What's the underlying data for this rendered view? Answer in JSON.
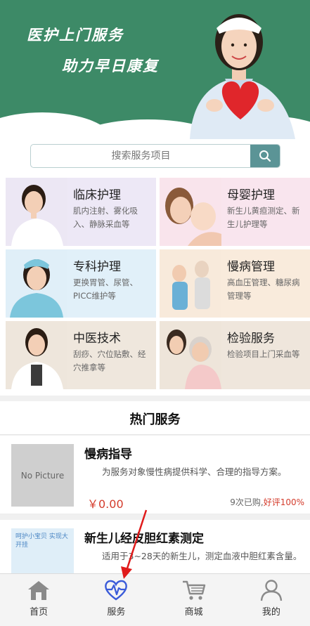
{
  "banner": {
    "line1": "医护上门服务",
    "line2": "助力早日康复"
  },
  "search": {
    "placeholder": "搜索服务项目"
  },
  "categories": [
    {
      "title": "临床护理",
      "desc": "肌内注射、雾化吸入、静脉采血等",
      "bg": "#ede8f6"
    },
    {
      "title": "母婴护理",
      "desc": "新生儿黄疸测定、新生儿护理等",
      "bg": "#f9e5ee"
    },
    {
      "title": "专科护理",
      "desc": "更换胃管、尿管、PICC维护等",
      "bg": "#e1f0f9"
    },
    {
      "title": "慢病管理",
      "desc": "高血压管理、糖尿病管理等",
      "bg": "#f9ebdc"
    },
    {
      "title": "中医技术",
      "desc": "刮痧、穴位贴敷、经穴推拿等",
      "bg": "#efe7dd"
    },
    {
      "title": "检验服务",
      "desc": "检验项目上门采血等",
      "bg": "#efe6dc"
    }
  ],
  "hot": {
    "title": "热门服务",
    "items": [
      {
        "name": "慢病指导",
        "detail": "为服务对象慢性病提供科学、合理的指导方案。",
        "price": "￥0.00",
        "sales": "9次已购,",
        "rating": "好评100%",
        "thumb_text": "No Picture"
      },
      {
        "name": "新生儿经皮胆红素测定",
        "detail": "适用于3~28天的新生儿，测定血液中胆红素含量。",
        "thumb_text": "呵护小宝贝 实现大开挂"
      }
    ]
  },
  "tabbar": {
    "tabs": [
      {
        "label": "首页",
        "icon": "home-icon"
      },
      {
        "label": "服务",
        "icon": "heartbeat-icon"
      },
      {
        "label": "商城",
        "icon": "cart-icon"
      },
      {
        "label": "我的",
        "icon": "user-icon"
      }
    ],
    "active": "服务"
  },
  "colors": {
    "banner": "#3d8a67",
    "search_button": "#5b9496",
    "price": "#d43c2c",
    "active_tab": "#3a5bd9"
  }
}
